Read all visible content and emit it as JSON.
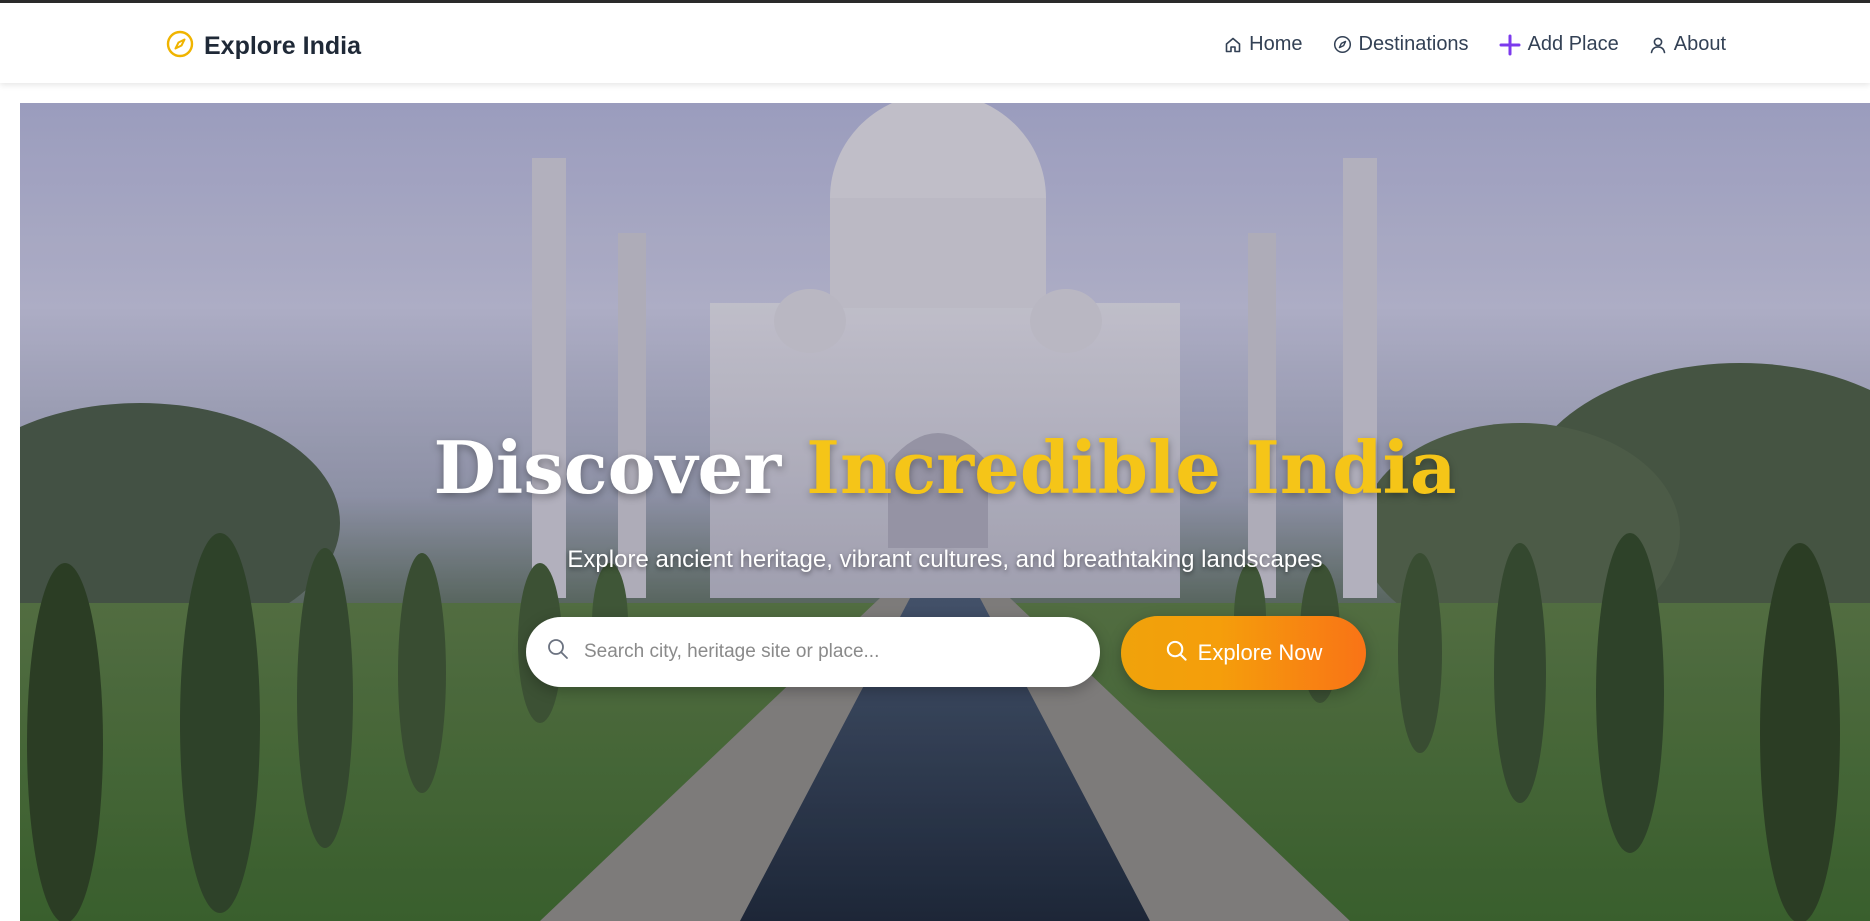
{
  "brand": {
    "name": "Explore India",
    "icon": "compass-icon",
    "icon_color": "#f0b400"
  },
  "nav": {
    "items": [
      {
        "label": "Home",
        "icon": "home-icon"
      },
      {
        "label": "Destinations",
        "icon": "compass-icon"
      },
      {
        "label": "Add Place",
        "icon": "plus-icon"
      },
      {
        "label": "About",
        "icon": "user-icon"
      }
    ]
  },
  "hero": {
    "title_main": "Discover",
    "title_accent": "Incredible India",
    "subtitle": "Explore ancient heritage, vibrant cultures, and breathtaking landscapes",
    "search_placeholder": "Search city, heritage site or place...",
    "search_value": "",
    "cta_label": "Explore Now",
    "background": "Taj Mahal photo"
  },
  "colors": {
    "accent": "#f5c518",
    "cta_start": "#f0a20b",
    "cta_end": "#f97316",
    "plus": "#7c3aed",
    "text_dark": "#1f2937"
  }
}
